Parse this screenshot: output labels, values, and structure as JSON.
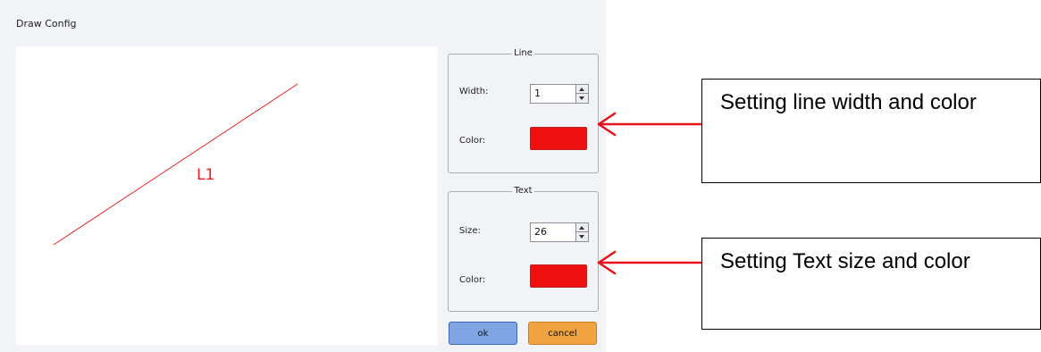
{
  "dialog": {
    "title": "Draw Config",
    "canvas": {
      "label": "L1",
      "line_color": "#ee1c1c"
    },
    "line_group": {
      "title": "Line",
      "width_label": "Width:",
      "width_value": "1",
      "color_label": "Color:",
      "color": "#ee0f0f"
    },
    "text_group": {
      "title": "Text",
      "size_label": "Size:",
      "size_value": "26",
      "color_label": "Color:",
      "color": "#ee0f0f"
    },
    "buttons": {
      "ok": "ok",
      "cancel": "cancel"
    }
  },
  "annotations": {
    "line_callout": "Setting line width and color",
    "text_callout": "Setting Text size and color",
    "arrow_color": "#e8101a"
  }
}
